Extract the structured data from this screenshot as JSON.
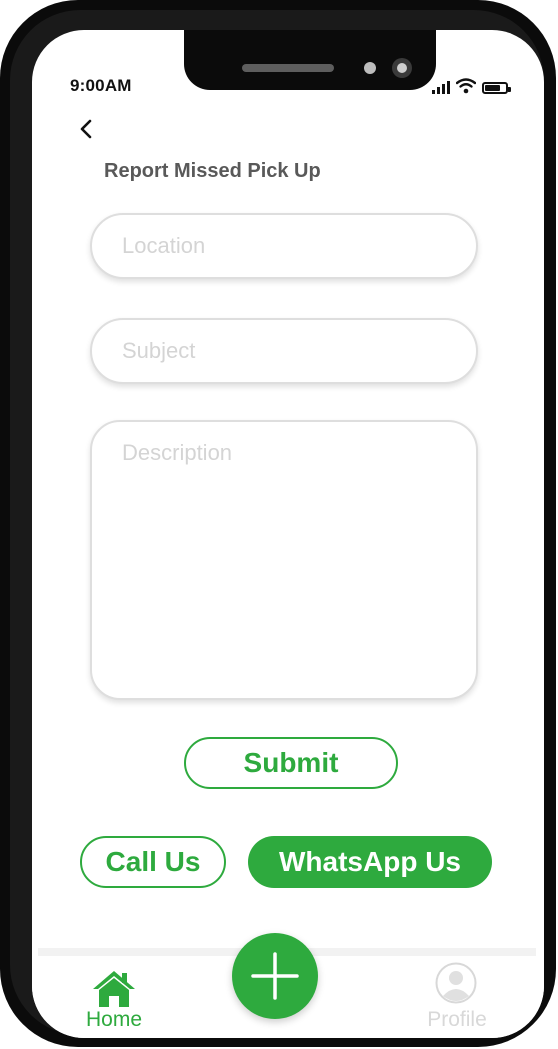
{
  "status_bar": {
    "time": "9:00AM"
  },
  "page": {
    "title": "Report Missed Pick Up"
  },
  "form": {
    "location": {
      "placeholder": "Location",
      "value": ""
    },
    "subject": {
      "placeholder": "Subject",
      "value": ""
    },
    "description": {
      "placeholder": "Description",
      "value": ""
    },
    "submit_label": "Submit"
  },
  "contact": {
    "call_label": "Call Us",
    "whatsapp_label": "WhatsApp Us"
  },
  "bottom_nav": {
    "home_label": "Home",
    "profile_label": "Profile"
  },
  "icons": {
    "back": "chevron-left-icon",
    "home": "home-icon",
    "add": "plus-icon",
    "profile": "user-avatar-icon",
    "signal": "signal-icon",
    "wifi": "wifi-icon",
    "battery": "battery-icon"
  },
  "colors": {
    "accent": "#2eaa3e",
    "placeholder": "#d4d4d4",
    "title": "#595959"
  }
}
